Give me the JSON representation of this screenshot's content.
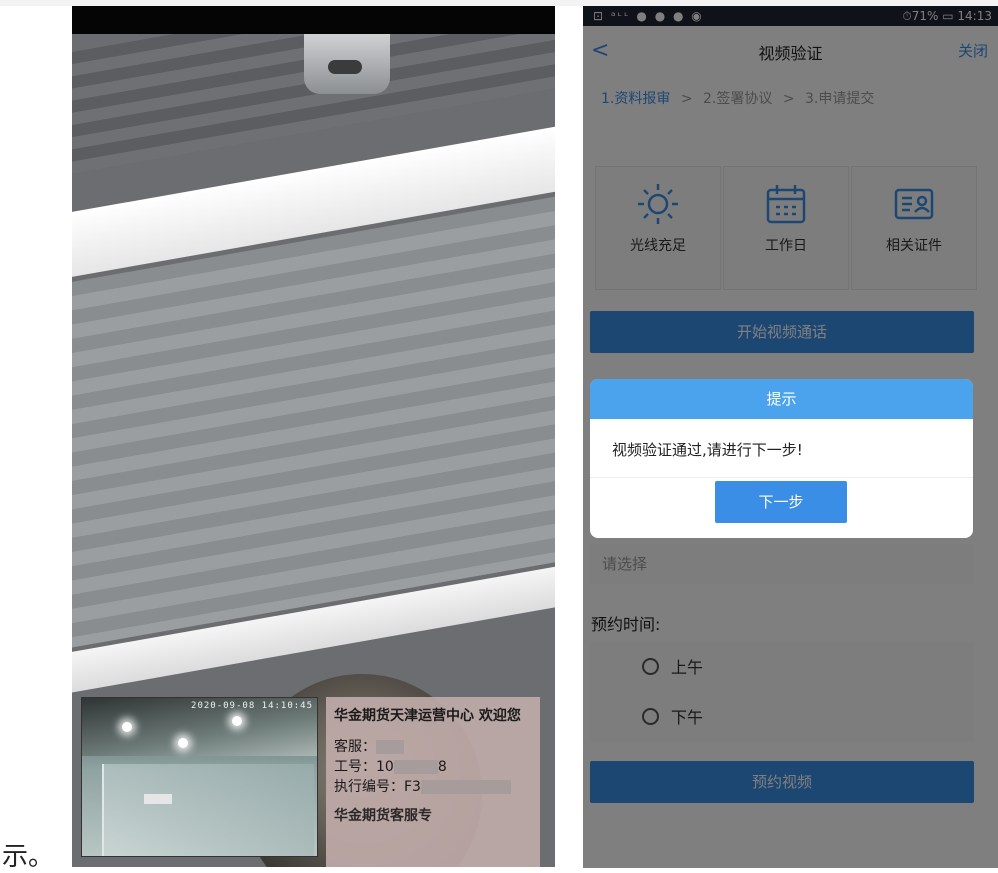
{
  "document": {
    "caption_char": "示。"
  },
  "video": {
    "timestamp": "2020-09-08 14:10:45",
    "welcome": "华金期货天津运营中心 欢迎您",
    "staff_label": "客服：",
    "id_label": "工号：10",
    "id_suffix": "8",
    "exec_label": "执行编号：F3",
    "bottom_text": "华金期货客服专"
  },
  "phone": {
    "status_left": "⊡ ᵃᶫᶫ ● ● ● ◉",
    "status_right": "⏱71% ▭ 14:13",
    "nav": {
      "back": "<",
      "title": "视频验证",
      "close": "关闭"
    },
    "steps": [
      "1.资料报审",
      ">",
      "2.签署协议",
      ">",
      "3.申请提交"
    ],
    "cards": [
      {
        "icon": "sun-icon",
        "label": "光线充足"
      },
      {
        "icon": "calendar-icon",
        "label": "工作日"
      },
      {
        "icon": "id-card-icon",
        "label": "相关证件"
      }
    ],
    "start_button": "开始视频通话",
    "select_placeholder": "请选择",
    "time_label": "预约时间:",
    "options": [
      "上午",
      "下午"
    ],
    "book_button": "预约视频",
    "dialog": {
      "title": "提示",
      "message": "视频验证通过,请进行下一步!",
      "next_button": "下一步"
    }
  }
}
